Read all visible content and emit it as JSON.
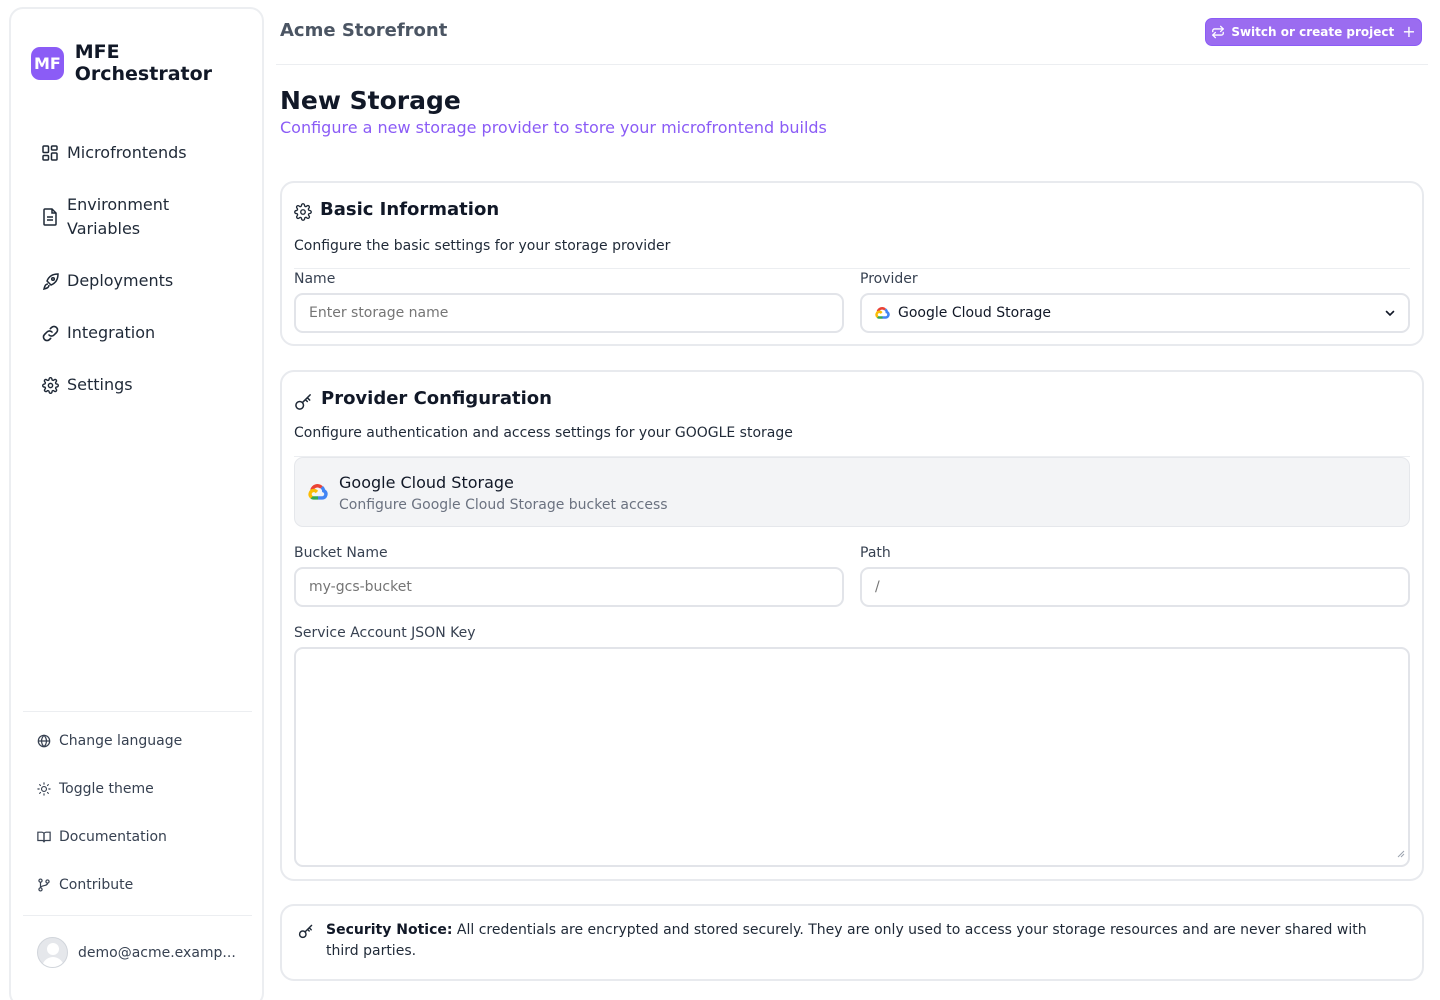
{
  "sidebar": {
    "logo_text": "MF",
    "app_name": "MFE Orchestrator",
    "nav": [
      {
        "label": "Microfrontends",
        "icon": "grid-icon"
      },
      {
        "label": "Environment Variables",
        "icon": "file-text-icon"
      },
      {
        "label": "Deployments",
        "icon": "rocket-icon"
      },
      {
        "label": "Integration",
        "icon": "link-icon"
      },
      {
        "label": "Settings",
        "icon": "gear-icon"
      }
    ],
    "footer": [
      {
        "label": "Change language",
        "icon": "globe-icon"
      },
      {
        "label": "Toggle theme",
        "icon": "sun-icon"
      },
      {
        "label": "Documentation",
        "icon": "book-icon"
      },
      {
        "label": "Contribute",
        "icon": "git-branch-icon"
      }
    ],
    "user_email": "demo@acme.examp..."
  },
  "header": {
    "project": "Acme Storefront",
    "switch_label": "Switch or create project",
    "switch_plus": "+"
  },
  "page": {
    "title": "New Storage",
    "subtitle": "Configure a new storage provider to store your microfrontend builds"
  },
  "basic": {
    "title": "Basic Information",
    "description": "Configure the basic settings for your storage provider",
    "name_label": "Name",
    "name_placeholder": "Enter storage name",
    "provider_label": "Provider",
    "provider_value": "Google Cloud Storage"
  },
  "provider_config": {
    "title": "Provider Configuration",
    "description": "Configure authentication and access settings for your GOOGLE storage",
    "box_title": "Google Cloud Storage",
    "box_desc": "Configure Google Cloud Storage bucket access",
    "bucket_label": "Bucket Name",
    "bucket_placeholder": "my-gcs-bucket",
    "path_label": "Path",
    "path_placeholder": "/",
    "json_label": "Service Account JSON Key",
    "json_value": ""
  },
  "notice": {
    "bold": "Security Notice:",
    "text": " All credentials are encrypted and stored securely. They are only used to access your storage resources and are never shared with third parties."
  },
  "colors": {
    "accent": "#8b5cf6",
    "button_bg": "#9b6cf0",
    "border": "#e8eaee"
  }
}
